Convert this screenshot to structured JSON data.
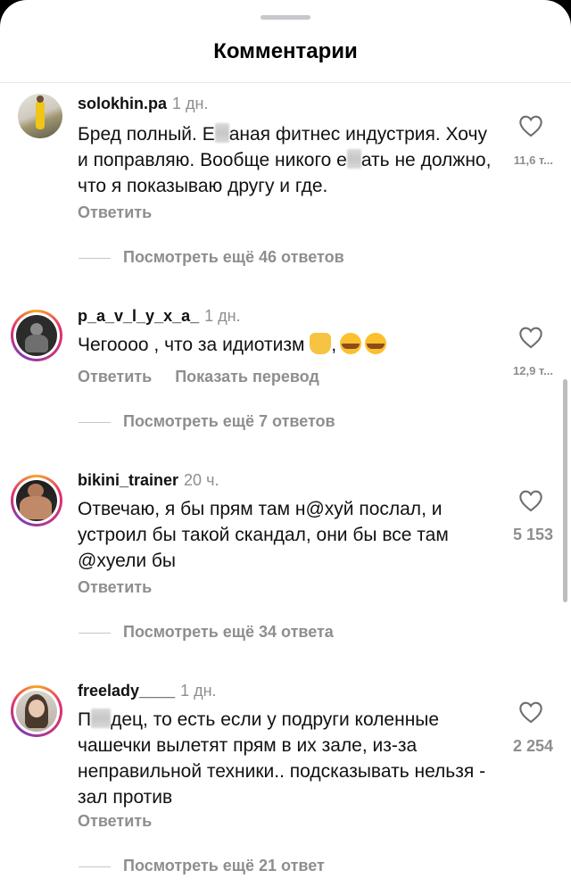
{
  "header": {
    "title": "Комментарии"
  },
  "comments": [
    {
      "username": "solokhin.pa",
      "time": "1 дн.",
      "text_parts": [
        "Бред полный. Е",
        "аная фитнес индустрия. Хочу и поправляю. Вообще никого е",
        "ать не должно, что я показываю другу и где."
      ],
      "reply_label": "Ответить",
      "likes": "11,6 т...",
      "view_replies": "Посмотреть ещё 46 ответов"
    },
    {
      "username": "p_a_v_l_y_x_a_",
      "time": "1 дн.",
      "text": "Чегоооо , что за идиотизм",
      "text_suffix": ",",
      "reply_label": "Ответить",
      "translate_label": "Показать перевод",
      "likes": "12,9 т...",
      "view_replies": "Посмотреть ещё 7 ответов"
    },
    {
      "username": "bikini_trainer",
      "time": "20 ч.",
      "text": "Отвечаю, я бы прям там н@хуй послал, и устроил бы такой скандал, они бы все там @хуели бы",
      "reply_label": "Ответить",
      "likes": "5 153",
      "view_replies": "Посмотреть ещё 34 ответа"
    },
    {
      "username": "freelady____",
      "time": "1 дн.",
      "text_parts": [
        "П",
        "дец, то есть если у подруги коленные чашечки вылетят прям в их зале, из-за неправильной техники.. подсказывать нельзя - зал против"
      ],
      "reply_label": "Ответить",
      "likes": "2 254",
      "view_replies": "Посмотреть ещё 21 ответ"
    }
  ],
  "icons": {
    "like": "heart-outline-icon",
    "emoji_1": "face-palm-emoji",
    "emoji_2": "tears-of-joy-emoji"
  },
  "colors": {
    "muted": "#8e8e8e",
    "story_ring": "#e1306c"
  }
}
